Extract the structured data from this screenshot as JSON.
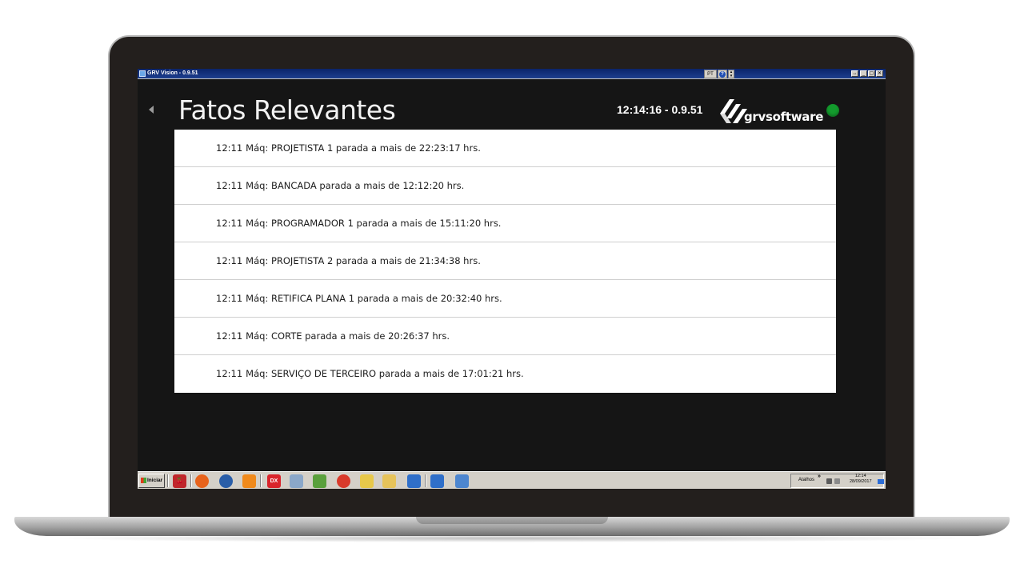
{
  "window": {
    "title": "GRV Vision - 0.9.51",
    "language_label": "PT",
    "help_label": "?",
    "controls": [
      "↔",
      "_",
      "▢",
      "✕"
    ]
  },
  "header": {
    "title": "Fatos Relevantes",
    "clock": "12:14:16 - 0.9.51",
    "brand": "grvsoftware",
    "status_color": "#139b2d"
  },
  "events": [
    {
      "time": "12:11",
      "text": "Máq: PROJETISTA 1 parada a mais de 22:23:17 hrs."
    },
    {
      "time": "12:11",
      "text": "Máq: BANCADA parada a mais de 12:12:20 hrs."
    },
    {
      "time": "12:11",
      "text": "Máq: PROGRAMADOR 1 parada a mais de 15:11:20 hrs."
    },
    {
      "time": "12:11",
      "text": "Máq: PROJETISTA 2 parada a mais de 21:34:38 hrs."
    },
    {
      "time": "12:11",
      "text": "Máq: RETIFICA PLANA 1 parada a mais de 20:32:40 hrs."
    },
    {
      "time": "12:11",
      "text": "Máq: CORTE parada a mais de 20:26:37 hrs."
    },
    {
      "time": "12:11",
      "text": "Máq: SERVIÇO DE TERCEIRO parada a mais de 17:01:21 hrs."
    }
  ],
  "taskbar": {
    "start_label": "Iniciar",
    "quicklaunch": [
      {
        "name": "cherry-icon",
        "color": "#c0262b",
        "glyph": "🍒"
      },
      {
        "name": "firefox-icon",
        "color": "#e8631b",
        "glyph": ""
      },
      {
        "name": "thunderbird-icon",
        "color": "#2a5ea8",
        "glyph": ""
      },
      {
        "name": "flame-icon",
        "color": "#f08a1c",
        "glyph": ""
      },
      {
        "name": "dx-icon",
        "color": "#d9242b",
        "glyph": "DX"
      },
      {
        "name": "network-tool-icon",
        "color": "#8aa7c9",
        "glyph": ""
      },
      {
        "name": "editor-icon",
        "color": "#5aa03c",
        "glyph": ""
      },
      {
        "name": "chrome-icon",
        "color": "#d93a2b",
        "glyph": ""
      },
      {
        "name": "notes-icon",
        "color": "#e7c84a",
        "glyph": ""
      },
      {
        "name": "folder-icon",
        "color": "#e6c35a",
        "glyph": ""
      },
      {
        "name": "remote-desktop-icon",
        "color": "#2f6fc9",
        "glyph": ""
      },
      {
        "name": "remote-desktop-2-icon",
        "color": "#2f6fc9",
        "glyph": ""
      },
      {
        "name": "calendar-icon",
        "color": "#4d86cf",
        "glyph": ""
      }
    ],
    "tray_label": "Atalhos",
    "tray_chevron": "»",
    "time": "12:14",
    "date": "28/09/2017"
  }
}
